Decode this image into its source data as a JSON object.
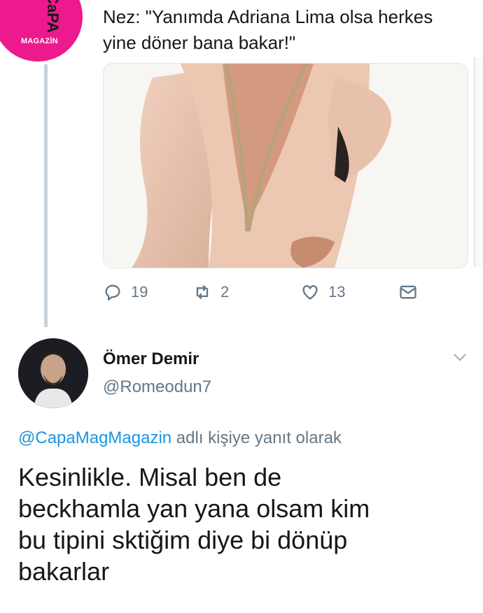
{
  "top_tweet": {
    "avatar_logo": "CaPA",
    "avatar_logo_sub": "MAGAZİN",
    "text": "Nez: \"Yanımda Adriana Lima olsa herkes\nyine döner bana bakar!\"",
    "media": {
      "description_icon": "photo-image"
    },
    "actions": {
      "reply_count": "19",
      "retweet_count": "2",
      "like_count": "13"
    }
  },
  "reply": {
    "display_name": "Ömer Demir",
    "handle": "@Romeodun7",
    "replying_to_mention": "@CapaMagMagazin",
    "replying_to_suffix": " adlı kişiye yanıt olarak",
    "text": "Kesinlikle. Misal ben de\nbeckhamla yan yana olsam kim\nbu tipini sktiğim diye bi dönüp\nbakarlar"
  },
  "colors": {
    "brand_pink": "#ec1a8c",
    "link_blue": "#1b95e0",
    "muted": "#657786"
  }
}
